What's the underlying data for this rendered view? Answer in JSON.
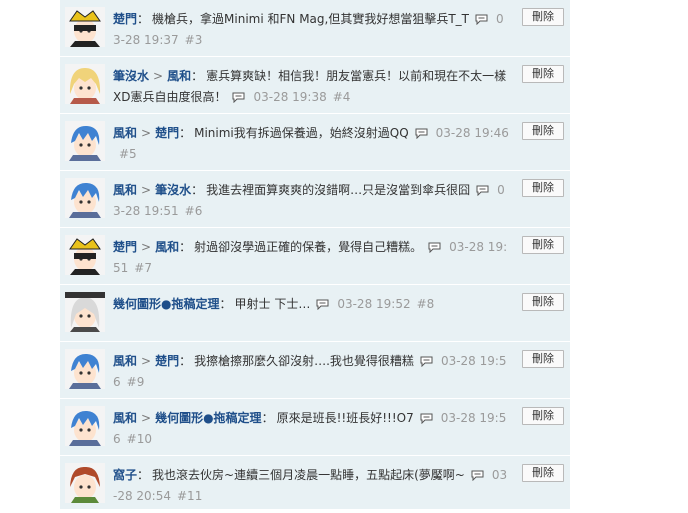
{
  "delete_label": "刪除",
  "comments": [
    {
      "avatar": "avatar-masked",
      "users": [
        "楚門"
      ],
      "text": "機槍兵，拿過Minimi 和FN Mag,但其實我好想當狙擊兵T_T",
      "time": "03-28 19:37",
      "floor": "#3"
    },
    {
      "avatar": "avatar-blonde",
      "users": [
        "筆沒水",
        "風和"
      ],
      "text": "憲兵算爽缺！相信我！朋友當憲兵！以前和現在不太一樣XD憲兵自由度很高！",
      "time": "03-28 19:38",
      "floor": "#4"
    },
    {
      "avatar": "avatar-blue-hair",
      "users": [
        "風和",
        "楚門"
      ],
      "text": "Minimi我有拆過保養過，始終沒射過QQ",
      "time": "03-28 19:46",
      "floor": "#5"
    },
    {
      "avatar": "avatar-blue-hair",
      "users": [
        "風和",
        "筆沒水"
      ],
      "text": "我進去裡面算爽爽的沒錯啊…只是沒當到傘兵很囧",
      "time": "03-28 19:51",
      "floor": "#6"
    },
    {
      "avatar": "avatar-masked",
      "users": [
        "楚門",
        "風和"
      ],
      "text": "射過卻沒學過正確的保養，覺得自己糟糕。",
      "time": "03-28 19:51",
      "floor": "#7"
    },
    {
      "avatar": "avatar-white-hair",
      "users": [
        "幾何圖形●拖稿定理"
      ],
      "text": "甲射士 下士…",
      "time": "03-28 19:52",
      "floor": "#8"
    },
    {
      "avatar": "avatar-blue-hair",
      "users": [
        "風和",
        "楚門"
      ],
      "text": "我擦槍擦那麼久卻沒射….我也覺得很糟糕",
      "time": "03-28 19:56",
      "floor": "#9"
    },
    {
      "avatar": "avatar-blue-hair",
      "users": [
        "風和",
        "幾何圖形●拖稿定理"
      ],
      "text": "原來是班長!!班長好!!!O7",
      "time": "03-28 19:56",
      "floor": "#10"
    },
    {
      "avatar": "avatar-red-hair",
      "users": [
        "窩子"
      ],
      "text": "我也滾去伙房~連續三個月凌晨一點睡，五點起床(夢魘啊~",
      "time": "03-28 20:54",
      "floor": "#11"
    }
  ]
}
